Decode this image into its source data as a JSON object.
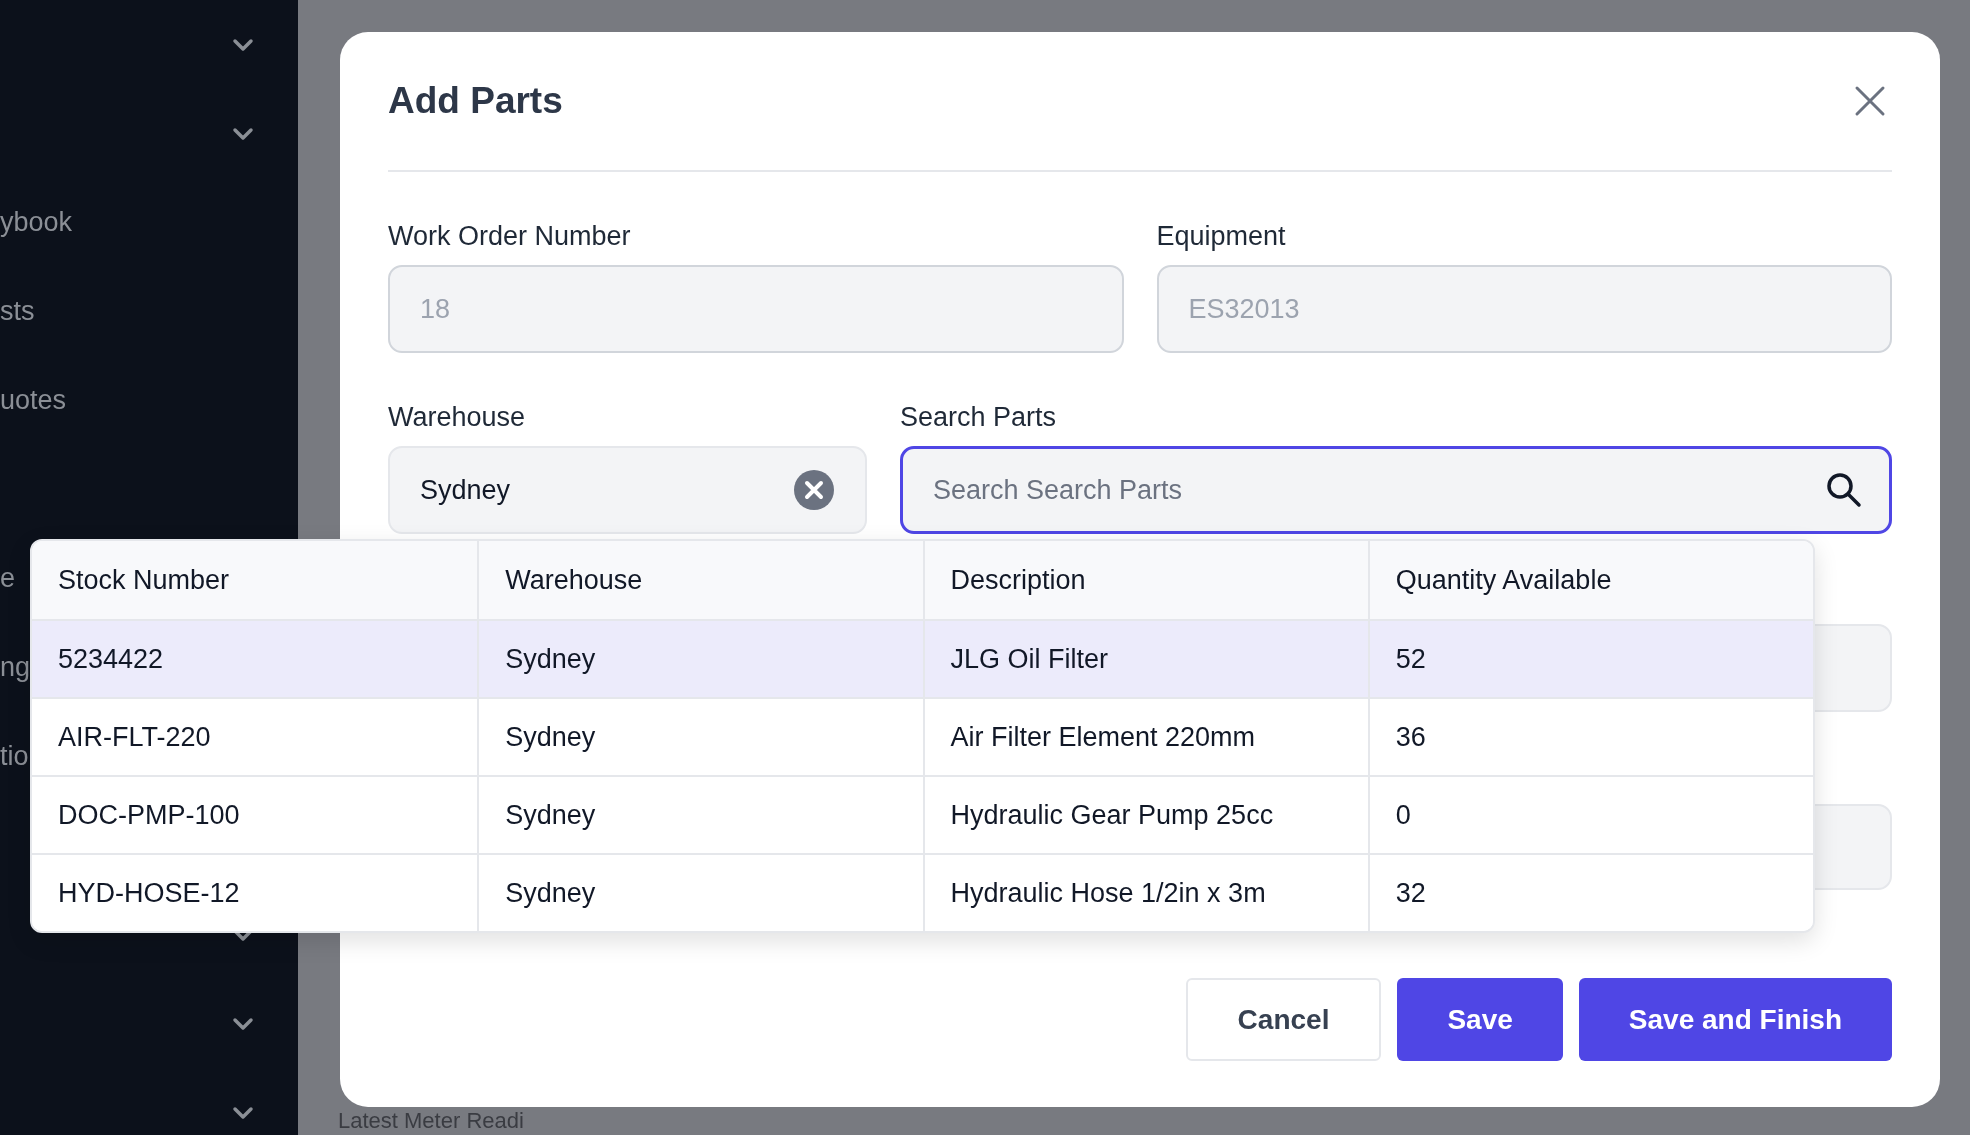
{
  "sidebar": {
    "items": [
      "ybook",
      "sts",
      "uotes",
      "e",
      "ng",
      "tio"
    ]
  },
  "background": {
    "heading": "Latest Meter Readi"
  },
  "dialog": {
    "title": "Add Parts",
    "fields": [
      {
        "label": "Work Order Number",
        "value": "18",
        "disabled": true
      },
      {
        "label": "Equipment",
        "value": "ES32013",
        "disabled": true
      }
    ],
    "warehouse": {
      "label": "Warehouse",
      "value": "Sydney"
    },
    "search": {
      "label": "Search Parts",
      "placeholder": "Search Search Parts",
      "focused": true
    },
    "buttons": [
      {
        "label": "Cancel",
        "kind": "secondary"
      },
      {
        "label": "Save",
        "kind": "primary"
      },
      {
        "label": "Save and Finish",
        "kind": "primary"
      }
    ]
  },
  "results": {
    "columns": [
      "Stock Number",
      "Warehouse",
      "Description",
      "Quantity Available"
    ],
    "rows": [
      {
        "cells": [
          "5234422",
          "Sydney",
          "JLG Oil Filter",
          "52"
        ],
        "selected": true
      },
      {
        "cells": [
          "AIR-FLT-220",
          "Sydney",
          "Air Filter Element 220mm",
          "36"
        ],
        "selected": false
      },
      {
        "cells": [
          "DOC-PMP-100",
          "Sydney",
          "Hydraulic Gear Pump 25cc",
          "0"
        ],
        "selected": false
      },
      {
        "cells": [
          "HYD-HOSE-12",
          "Sydney",
          "Hydraulic Hose 1/2in x 3m",
          "32"
        ],
        "selected": false
      }
    ]
  }
}
